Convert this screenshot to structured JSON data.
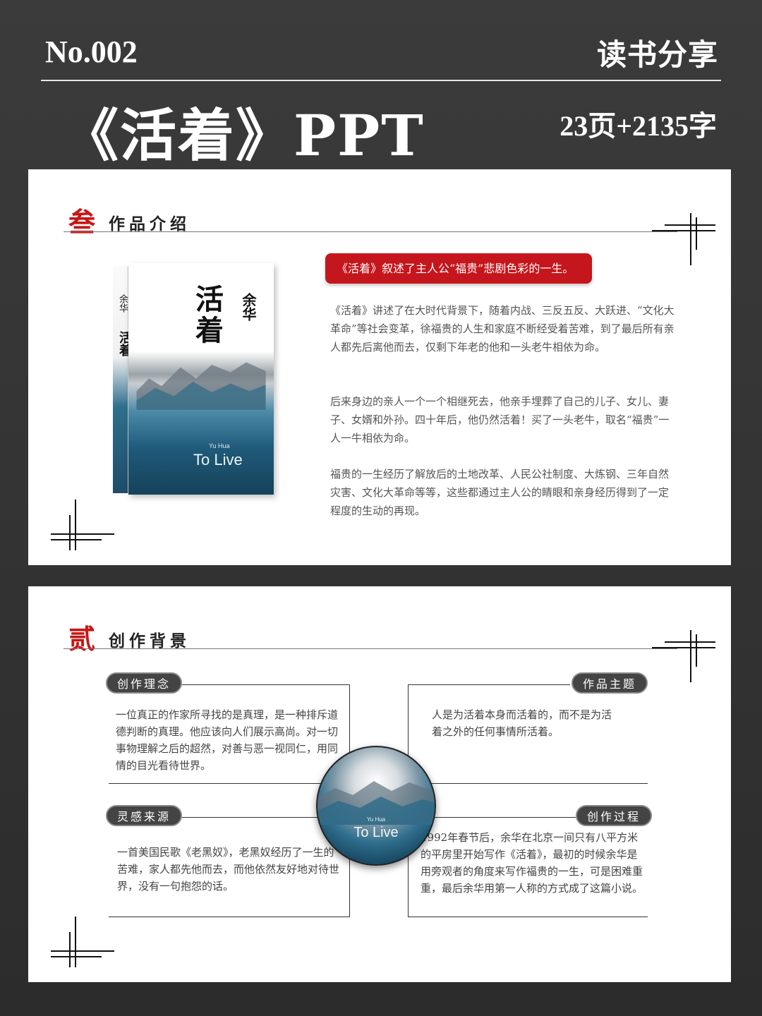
{
  "header": {
    "number": "No.002",
    "tag": "读书分享",
    "title": "《活着》PPT",
    "count": "23页+2135字"
  },
  "slide1": {
    "section_num": "叁",
    "section_title": "作品介绍",
    "book": {
      "spine_author": "余华",
      "spine_title": "活着",
      "cover_title": "活着",
      "cover_author": "余华",
      "cover_en_small": "Yu Hua",
      "cover_en": "To Live"
    },
    "banner": "《活着》叙述了主人公“福贵”悲剧色彩的一生。",
    "paragraphs": [
      "《活着》讲述了在大时代背景下，随着内战、三反五反、大跃进、“文化大革命”等社会变革，徐福贵的人生和家庭不断经受着苦难，到了最后所有亲人都先后离他而去，仅剩下年老的他和一头老牛相依为命。",
      "后来身边的亲人一个一个相继死去，他亲手埋葬了自己的儿子、女儿、妻子、女婿和外孙。四十年后，他仍然活着！买了一头老牛，取名“福贵”一人一牛相依为命。",
      "福贵的一生经历了解放后的土地改革、人民公社制度、大炼钢、三年自然灾害、文化大革命等等，这些都通过主人公的睛眼和亲身经历得到了一定程度的生动的再现。"
    ]
  },
  "slide2": {
    "section_num": "贰",
    "section_title": "创作背景",
    "circle": {
      "en_small": "Yu Hua",
      "en": "To Live"
    },
    "boxes": [
      {
        "label": "创作理念",
        "text": "一位真正的作家所寻找的是真理，是一种排斥道德判断的真理。他应该向人们展示高尚。对一切事物理解之后的超然，对善与恶一视同仁，用同情的目光看待世界。"
      },
      {
        "label": "作品主题",
        "text": "人是为活着本身而活着的，而不是为活着之外的任何事情所活着。"
      },
      {
        "label": "灵感来源",
        "text": "一首美国民歌《老黑奴》，老黑奴经历了一生的苦难，家人都先他而去，而他依然友好地对待世界，没有一句抱怨的话。"
      },
      {
        "label": "创作过程",
        "text": "1992年春节后，余华在北京一间只有八平方米的平房里开始写作《活着》，最初的时候余华是用旁观者的角度来写作福贵的一生，可是困难重重，最后余华用第一人称的方式成了这篇小说。"
      }
    ]
  }
}
